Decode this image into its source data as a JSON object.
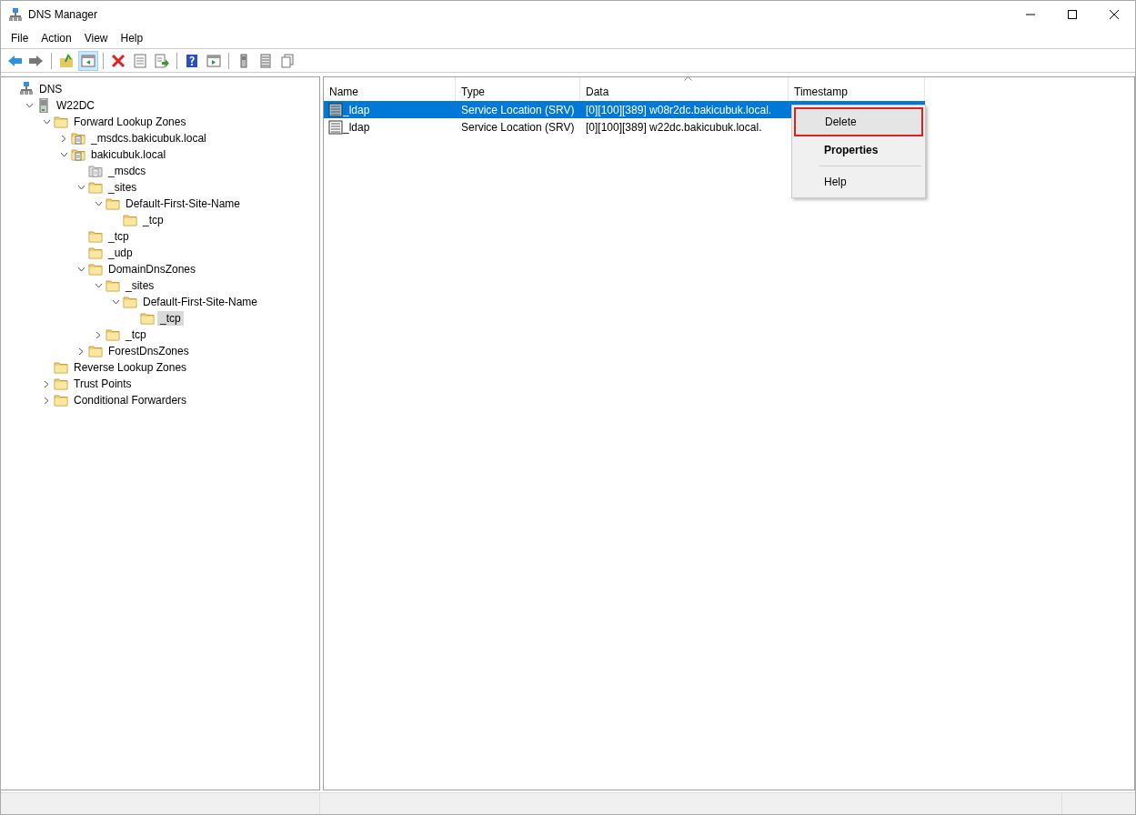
{
  "window": {
    "title": "DNS Manager"
  },
  "menu": [
    "File",
    "Action",
    "View",
    "Help"
  ],
  "toolbar": [
    {
      "kind": "back",
      "pressed": false
    },
    {
      "kind": "forward",
      "pressed": false
    },
    {
      "kind": "sep"
    },
    {
      "kind": "up",
      "pressed": false
    },
    {
      "kind": "tree",
      "pressed": true
    },
    {
      "kind": "sep"
    },
    {
      "kind": "delete",
      "pressed": false
    },
    {
      "kind": "properties",
      "pressed": false
    },
    {
      "kind": "export",
      "pressed": false
    },
    {
      "kind": "sep"
    },
    {
      "kind": "help",
      "pressed": false
    },
    {
      "kind": "pane",
      "pressed": false
    },
    {
      "kind": "sep"
    },
    {
      "kind": "server",
      "pressed": false
    },
    {
      "kind": "list",
      "pressed": false
    },
    {
      "kind": "copy",
      "pressed": false
    }
  ],
  "tree": [
    {
      "label": "DNS",
      "kind": "dns",
      "selected": false,
      "children": [
        {
          "label": "W22DC",
          "kind": "server",
          "expanded": true,
          "selected": false,
          "children": [
            {
              "label": "Forward Lookup Zones",
              "kind": "folder",
              "expanded": true,
              "selected": false,
              "children": [
                {
                  "label": "_msdcs.bakicubuk.local",
                  "kind": "zone",
                  "expanded": false,
                  "selected": false
                },
                {
                  "label": "bakicubuk.local",
                  "kind": "zone",
                  "expanded": true,
                  "selected": false,
                  "children": [
                    {
                      "label": "_msdcs",
                      "kind": "delegation",
                      "selected": false
                    },
                    {
                      "label": "_sites",
                      "kind": "folder",
                      "expanded": true,
                      "selected": false,
                      "children": [
                        {
                          "label": "Default-First-Site-Name",
                          "kind": "folder",
                          "expanded": true,
                          "selected": false,
                          "children": [
                            {
                              "label": "_tcp",
                              "kind": "folder",
                              "selected": false
                            }
                          ]
                        }
                      ]
                    },
                    {
                      "label": "_tcp",
                      "kind": "folder",
                      "selected": false
                    },
                    {
                      "label": "_udp",
                      "kind": "folder",
                      "selected": false
                    },
                    {
                      "label": "DomainDnsZones",
                      "kind": "folder",
                      "expanded": true,
                      "selected": false,
                      "children": [
                        {
                          "label": "_sites",
                          "kind": "folder",
                          "expanded": true,
                          "selected": false,
                          "children": [
                            {
                              "label": "Default-First-Site-Name",
                              "kind": "folder",
                              "expanded": true,
                              "selected": false,
                              "children": [
                                {
                                  "label": "_tcp",
                                  "kind": "folder",
                                  "selected": true
                                }
                              ]
                            }
                          ]
                        },
                        {
                          "label": "_tcp",
                          "kind": "folder",
                          "expanded": false,
                          "selected": false
                        }
                      ]
                    },
                    {
                      "label": "ForestDnsZones",
                      "kind": "folder",
                      "expanded": false,
                      "selected": false
                    }
                  ]
                }
              ]
            },
            {
              "label": "Reverse Lookup Zones",
              "kind": "folder",
              "selected": false
            },
            {
              "label": "Trust Points",
              "kind": "folder",
              "expanded": false,
              "selected": false
            },
            {
              "label": "Conditional Forwarders",
              "kind": "folder",
              "expanded": false,
              "selected": false
            }
          ]
        }
      ]
    }
  ],
  "table": {
    "columns": [
      {
        "label": "Name",
        "sorted": false
      },
      {
        "label": "Type",
        "sorted": false
      },
      {
        "label": "Data",
        "sorted": true
      },
      {
        "label": "Timestamp",
        "sorted": false
      }
    ],
    "rows": [
      {
        "cells": [
          "_ldap",
          "Service Location (SRV)",
          "[0][100][389] w08r2dc.bakicubuk.local."
        ],
        "selected": true
      },
      {
        "cells": [
          "_ldap",
          "Service Location (SRV)",
          "[0][100][389] w22dc.bakicubuk.local."
        ],
        "selected": false
      }
    ]
  },
  "context_menu": [
    {
      "kind": "item",
      "label": "Delete",
      "bold": false,
      "highlighted": true
    },
    {
      "kind": "item",
      "label": "Properties",
      "bold": true,
      "highlighted": false
    },
    {
      "kind": "separator"
    },
    {
      "kind": "item",
      "label": "Help",
      "bold": false,
      "highlighted": false
    }
  ]
}
